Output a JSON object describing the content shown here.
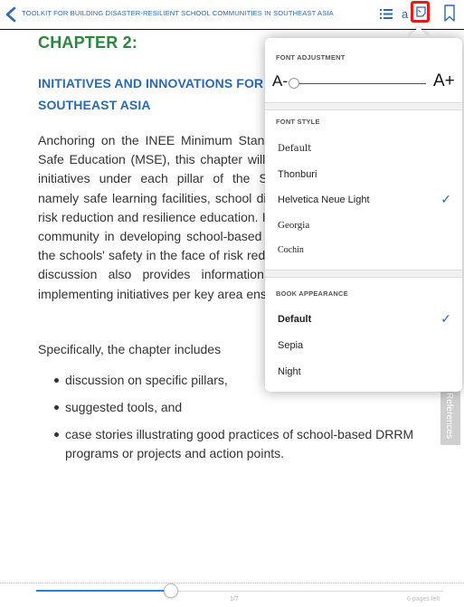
{
  "topbar": {
    "book_title": "TOOLKIT FOR BUILDING DISASTER-RESILIENT SCHOOL COMMUNITIES IN SOUTHEAST ASIA",
    "font_button_label": "a",
    "accent_color": "#2a6ab5",
    "highlight_color": "#e41b17"
  },
  "content": {
    "chapter": "CHAPTER 2:",
    "section_title": "INITIATIVES AND INNOVATIONS FOR SAFE SCHOOLS IN SOUTHEAST ASIA",
    "paragraph": "Anchoring on the INEE Minimum Standards and the Model for Safe Education (MSE), this chapter will take an in-depth look at initiatives under each pillar of the Safe School Framework, namely safe learning facilities, school disaster management, and risk reduction and resilience education. It highlights the role of the community in developing school-based solutions that strengthen the schools' safety in the face of risk reduction and response. The discussion also provides information on the 'how to's' of implementing initiatives per key area ensuring school safety.",
    "intro": "Specifically, the chapter includes",
    "bullets": [
      "discussion on specific pillars,",
      "suggested tools, and",
      "case stories illustrating good practices of school-based DRRM programs or projects and action points."
    ],
    "references_tab": "References"
  },
  "popover": {
    "font_adjustment_label": "FONT ADJUSTMENT",
    "font_smaller": "A-",
    "font_larger": "A+",
    "font_style_label": "FONT STYLE",
    "font_styles": [
      {
        "label": "Default",
        "selected": false
      },
      {
        "label": "Thonburi",
        "selected": false
      },
      {
        "label": "Helvetica Neue Light",
        "selected": true
      },
      {
        "label": "Georgia",
        "selected": false
      },
      {
        "label": "Cochin",
        "selected": false
      }
    ],
    "book_appearance_label": "BOOK APPEARANCE",
    "appearances": [
      {
        "label": "Default",
        "selected": true
      },
      {
        "label": "Sepia",
        "selected": false
      },
      {
        "label": "Night",
        "selected": false
      }
    ],
    "checkmark": "✓"
  },
  "footer": {
    "page_number": "1/7",
    "pages_left": "6 pages left",
    "progress_fraction": 0.33
  }
}
